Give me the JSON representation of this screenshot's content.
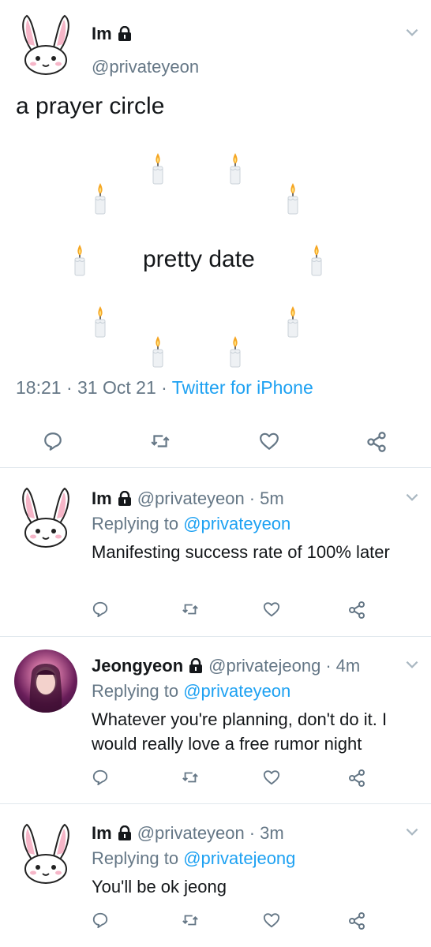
{
  "main_tweet": {
    "display_name": "Im",
    "handle": "@privateyeon",
    "text": "a prayer circle",
    "center_text": "pretty date",
    "candle_emoji": "candle",
    "time": "18:21",
    "date": "31 Oct 21",
    "source": "Twitter for iPhone",
    "icons": [
      "lock-icon",
      "chevron-down-icon",
      "reply-icon",
      "retweet-icon",
      "like-icon",
      "share-icon"
    ]
  },
  "replies": [
    {
      "display_name": "Im",
      "handle": "@privateyeon",
      "time": "5m",
      "replying_label": "Replying to",
      "replying_to": "@privateyeon",
      "text": "Manifesting success rate of 100% later",
      "avatar": "bunny"
    },
    {
      "display_name": "Jeongyeon",
      "handle": "@privatejeong",
      "time": "4m",
      "replying_label": "Replying to",
      "replying_to": "@privateyeon",
      "text": "Whatever you're planning, don't do it. I would really love a free rumor night",
      "avatar": "photo"
    },
    {
      "display_name": "Im",
      "handle": "@privateyeon",
      "time": "3m",
      "replying_label": "Replying to",
      "replying_to": "@privatejeong",
      "text": "You'll be ok jeong",
      "avatar": "bunny"
    }
  ],
  "colors": {
    "link": "#1da1f2",
    "muted": "#657786",
    "text": "#14171a",
    "divider": "#e1e8ed"
  }
}
